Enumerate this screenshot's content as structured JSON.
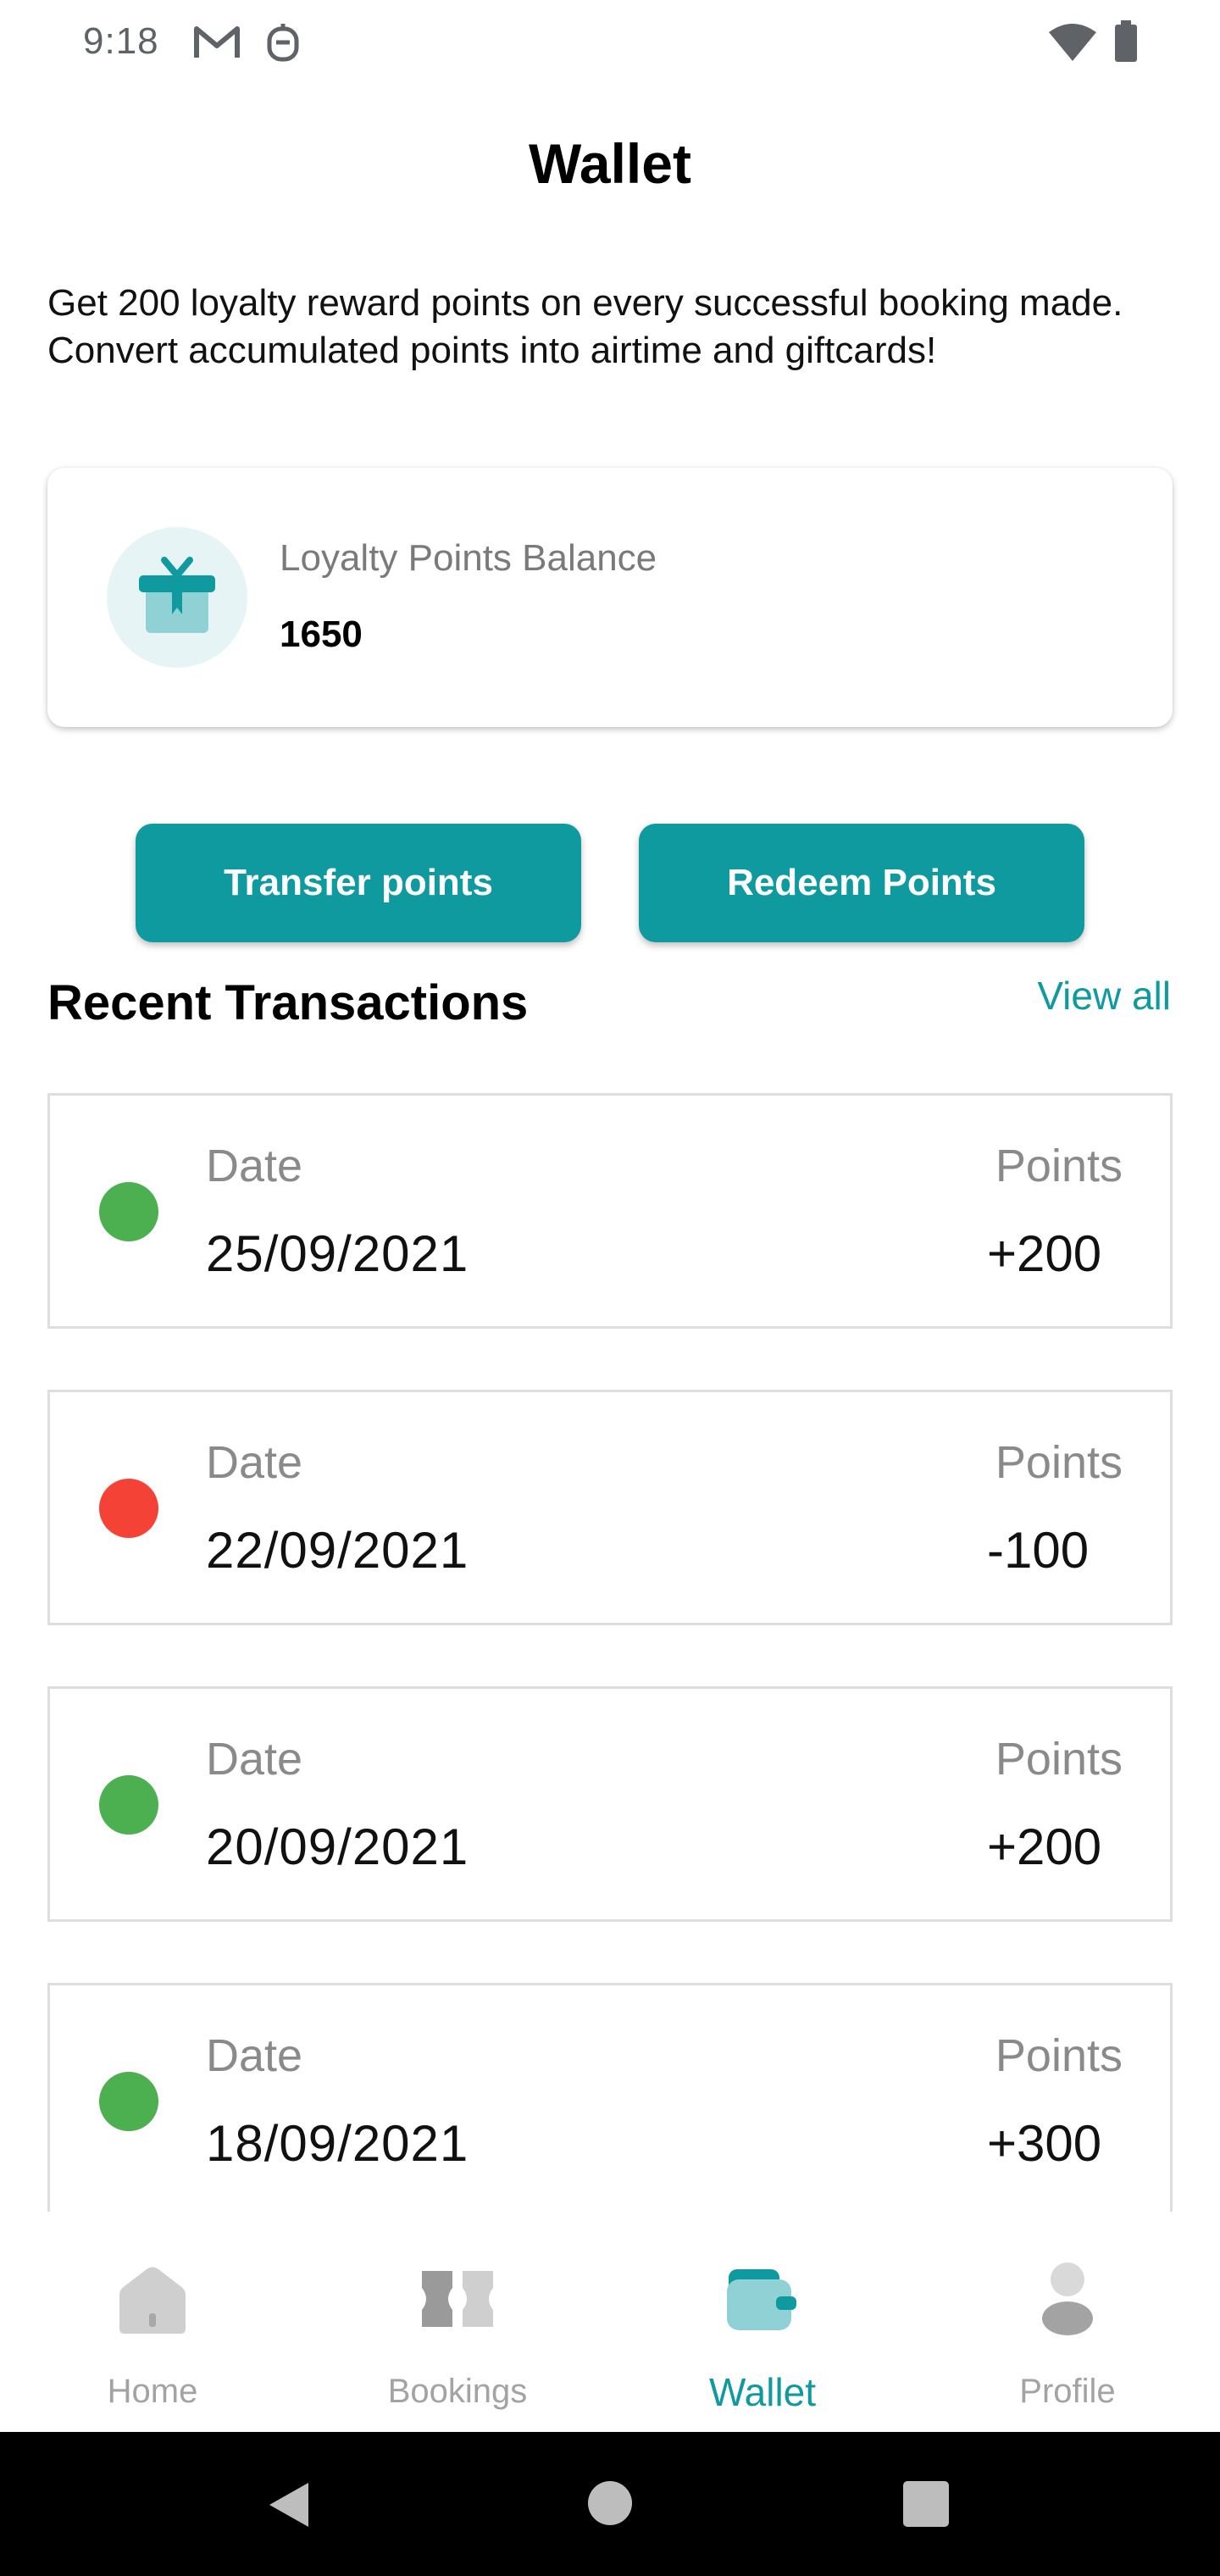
{
  "status_bar": {
    "time": "9:18",
    "icons": [
      "gmail-icon",
      "notification-icon",
      "wifi-icon",
      "battery-icon"
    ]
  },
  "header": {
    "title": "Wallet"
  },
  "intro_text": "Get 200 loyalty reward points on every successful booking made. Convert accumulated points into airtime and giftcards!",
  "loyalty": {
    "label": "Loyalty Points Balance",
    "value": "1650",
    "icon": "gift-icon"
  },
  "actions": {
    "transfer_label": "Transfer points",
    "redeem_label": "Redeem Points"
  },
  "transactions": {
    "title": "Recent Transactions",
    "view_all": "View all",
    "items": [
      {
        "date_label": "Date",
        "date": "25/09/2021",
        "points_label": "Points",
        "points": "+200",
        "status_color": "#4caf50"
      },
      {
        "date_label": "Date",
        "date": "22/09/2021",
        "points_label": "Points",
        "points": "-100",
        "status_color": "#f44336"
      },
      {
        "date_label": "Date",
        "date": "20/09/2021",
        "points_label": "Points",
        "points": "+200",
        "status_color": "#4caf50"
      },
      {
        "date_label": "Date",
        "date": "18/09/2021",
        "points_label": "Points",
        "points": "+300",
        "status_color": "#4caf50"
      }
    ]
  },
  "bottom_nav": {
    "items": [
      {
        "label": "Home",
        "icon": "home-icon",
        "active": false
      },
      {
        "label": "Bookings",
        "icon": "ticket-icon",
        "active": false
      },
      {
        "label": "Wallet",
        "icon": "wallet-icon",
        "active": true
      },
      {
        "label": "Profile",
        "icon": "profile-icon",
        "active": false
      }
    ]
  },
  "colors": {
    "accent": "#0f9aa0",
    "positive": "#4caf50",
    "negative": "#f44336",
    "muted": "#a3a3a3"
  },
  "system_nav": {
    "icons": [
      "back-icon",
      "home-circle-icon",
      "recents-icon"
    ]
  }
}
